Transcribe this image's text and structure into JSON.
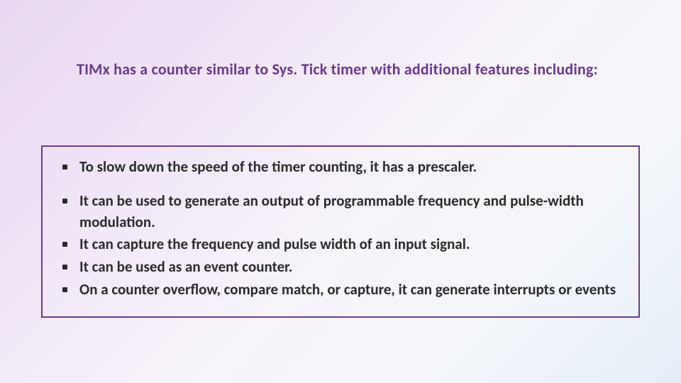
{
  "title": "TIMx has a counter similar to Sys. Tick timer with additional features including:",
  "group1": {
    "items": [
      "To slow down the speed of the timer counting, it has a prescaler."
    ]
  },
  "group2": {
    "items": [
      "It can be used to generate an output of programmable frequency and pulse-width modulation.",
      "It can capture the frequency and pulse width of an input signal.",
      "It can be used as an event counter.",
      "On a counter overflow, compare match, or capture, it can generate interrupts or events"
    ]
  }
}
